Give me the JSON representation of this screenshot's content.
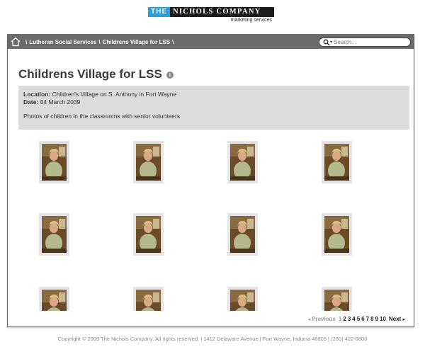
{
  "logo": {
    "the": "THE",
    "name": "NICHOLS COMPANY",
    "subtitle": "marketing services"
  },
  "breadcrumb": {
    "items": [
      "Lutheran Social Services",
      "Childrens Village for LSS"
    ],
    "separator": "\\"
  },
  "search": {
    "placeholder": "Search..."
  },
  "album": {
    "title": "Childrens Village for LSS",
    "location_label": "Location:",
    "location_value": "Children's Village on S. Anthony in Fort Wayne",
    "date_label": "Date:",
    "date_value": "04 March 2009",
    "description": "Photos of children in the classrooms with senior volunteers"
  },
  "thumbnails_count": 12,
  "pager": {
    "prev": "Previous",
    "next": "Next",
    "pages": [
      "1",
      "2",
      "3",
      "4",
      "5",
      "6",
      "7",
      "8",
      "9",
      "10"
    ],
    "current": "1"
  },
  "footer": {
    "text": "Copyright © 2009 The Nichols Company. All rights reserved. | 1412 Delaware Avenue | Fort Wayne, Indiana 46805 | (260) 422-6800"
  },
  "colors": {
    "topbar": "#6b6b6b",
    "meta_bg": "#dcdcdc",
    "logo_blue": "#2a9fd8",
    "logo_dark": "#1c1c1c"
  }
}
